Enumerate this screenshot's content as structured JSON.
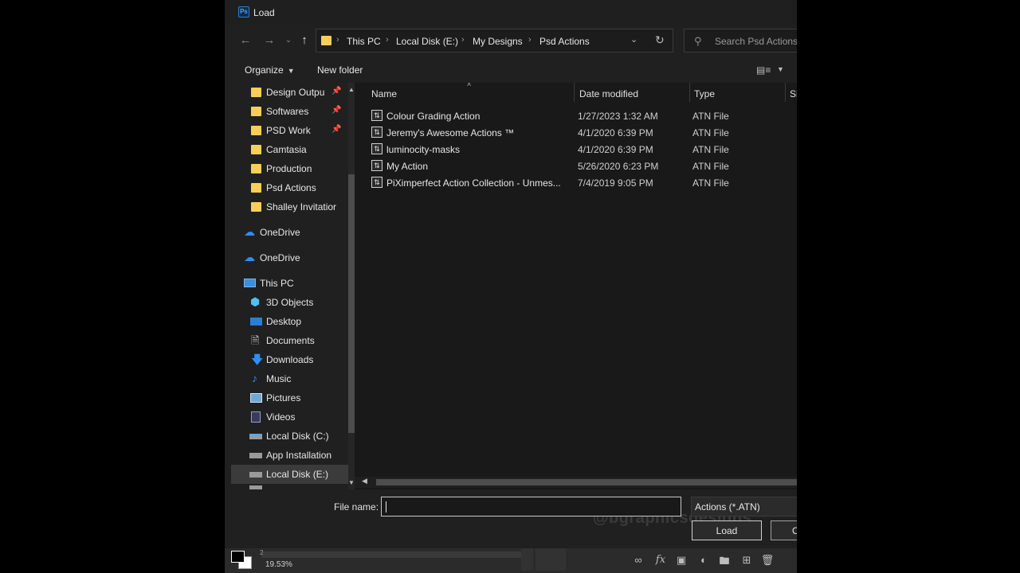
{
  "window": {
    "title": "Load",
    "app_icon": "Ps"
  },
  "address_bar": {
    "crumbs": [
      "This PC",
      "Local Disk (E:)",
      "My Designs",
      "Psd Actions"
    ],
    "search_placeholder": "Search Psd Actions"
  },
  "toolbar": {
    "organize_label": "Organize",
    "new_folder_label": "New folder"
  },
  "nav_pane": {
    "quick_access": [
      {
        "label": "Design Outpu",
        "pinned": true
      },
      {
        "label": "Softwares",
        "pinned": true
      },
      {
        "label": "PSD Work",
        "pinned": true
      },
      {
        "label": "Camtasia",
        "pinned": false
      },
      {
        "label": "Production",
        "pinned": false
      },
      {
        "label": "Psd Actions",
        "pinned": false
      },
      {
        "label": "Shalley Invitatior",
        "pinned": false
      }
    ],
    "onedrive": [
      "OneDrive",
      "OneDrive"
    ],
    "this_pc": "This PC",
    "pc_items": [
      {
        "label": "3D Objects",
        "icon": "3d-objects-icon"
      },
      {
        "label": "Desktop",
        "icon": "desktop-icon"
      },
      {
        "label": "Documents",
        "icon": "documents-icon"
      },
      {
        "label": "Downloads",
        "icon": "downloads-icon"
      },
      {
        "label": "Music",
        "icon": "music-icon"
      },
      {
        "label": "Pictures",
        "icon": "pictures-icon"
      },
      {
        "label": "Videos",
        "icon": "videos-icon"
      },
      {
        "label": "Local Disk (C:)",
        "icon": "drive-icon"
      },
      {
        "label": "App Installation",
        "icon": "drive-icon"
      },
      {
        "label": "Local Disk (E:)",
        "icon": "drive-icon"
      }
    ]
  },
  "file_list": {
    "columns": {
      "name": "Name",
      "date": "Date modified",
      "type": "Type",
      "size": "Si"
    },
    "rows": [
      {
        "name": "Colour Grading Action",
        "date": "1/27/2023 1:32 AM",
        "type": "ATN File"
      },
      {
        "name": "Jeremy's Awesome Actions ™",
        "date": "4/1/2020 6:39 PM",
        "type": "ATN File"
      },
      {
        "name": "luminocity-masks",
        "date": "4/1/2020 6:39 PM",
        "type": "ATN File"
      },
      {
        "name": "My Action",
        "date": "5/26/2020 6:23 PM",
        "type": "ATN File"
      },
      {
        "name": "PiXimperfect Action Collection - Unmes...",
        "date": "7/4/2019 9:05 PM",
        "type": "ATN File"
      }
    ]
  },
  "bottom": {
    "file_name_label": "File name:",
    "file_name_value": "",
    "file_type_value": "Actions (*.ATN)",
    "load_label": "Load",
    "cancel_label": "C",
    "watermark": "@bgraphicsdesigns"
  },
  "ps_status": {
    "zoom": "19.53%",
    "doc_num": "2"
  },
  "colors": {
    "folder": "#f7cf58",
    "onedrive": "#2f8ef2",
    "background": "#202020",
    "list_background": "#191919"
  }
}
